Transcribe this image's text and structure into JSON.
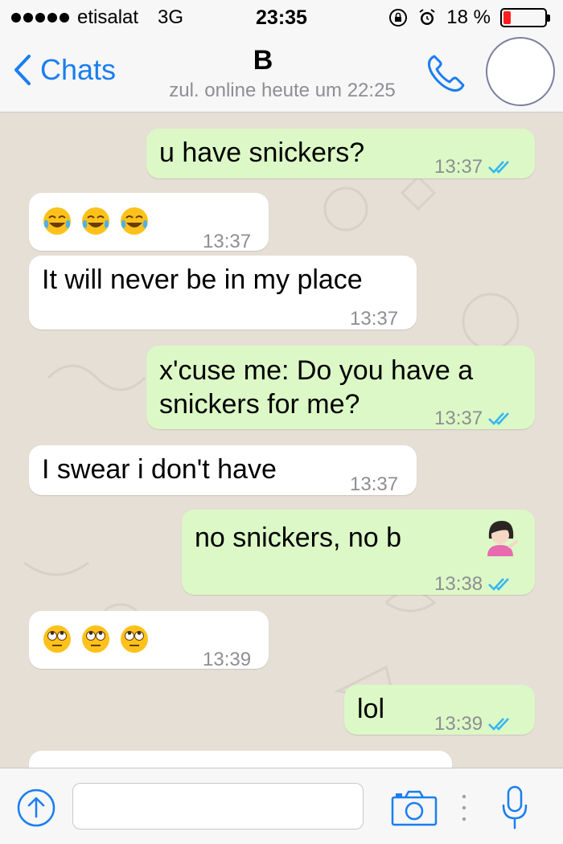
{
  "status_bar": {
    "carrier": "etisalat",
    "network": "3G",
    "time": "23:35",
    "battery_percent": "18 %",
    "battery_level": 0.18,
    "battery_color": "#ff1e1e"
  },
  "nav": {
    "back_label": "Chats",
    "contact_name": "B",
    "last_seen": "zul. online heute um 22:25",
    "accent_color": "#1a7ef0"
  },
  "messages": [
    {
      "direction": "outgoing",
      "text": "u have snickers?",
      "time": "13:37",
      "read": true
    },
    {
      "direction": "incoming",
      "emoji": [
        "face-with-tears-of-joy",
        "face-with-tears-of-joy",
        "face-with-tears-of-joy"
      ],
      "time": "13:37"
    },
    {
      "direction": "incoming",
      "text": "It will never be in my place",
      "time": "13:37"
    },
    {
      "direction": "outgoing",
      "text_lines": [
        "x'cuse me: Do you have a",
        "snickers for me?"
      ],
      "time": "13:37",
      "read": true
    },
    {
      "direction": "incoming",
      "text": "I swear i don't have",
      "time": "13:37"
    },
    {
      "direction": "outgoing",
      "text": "no snickers, no b",
      "emoji": [
        "information-desk-person"
      ],
      "time": "13:38",
      "read": true
    },
    {
      "direction": "incoming",
      "emoji": [
        "face-with-rolling-eyes",
        "face-with-rolling-eyes",
        "face-with-rolling-eyes"
      ],
      "time": "13:39"
    },
    {
      "direction": "outgoing",
      "text": "lol",
      "time": "13:39",
      "read": true
    }
  ],
  "input_bar": {
    "value": "",
    "icons": [
      "plus-circle-icon",
      "camera-icon",
      "more-dots-icon",
      "microphone-icon"
    ]
  },
  "colors": {
    "outgoing_bubble": "#dcf8c6",
    "incoming_bubble": "#ffffff",
    "chat_background": "#e6dfd5",
    "read_ticks": "#34b7f1"
  }
}
